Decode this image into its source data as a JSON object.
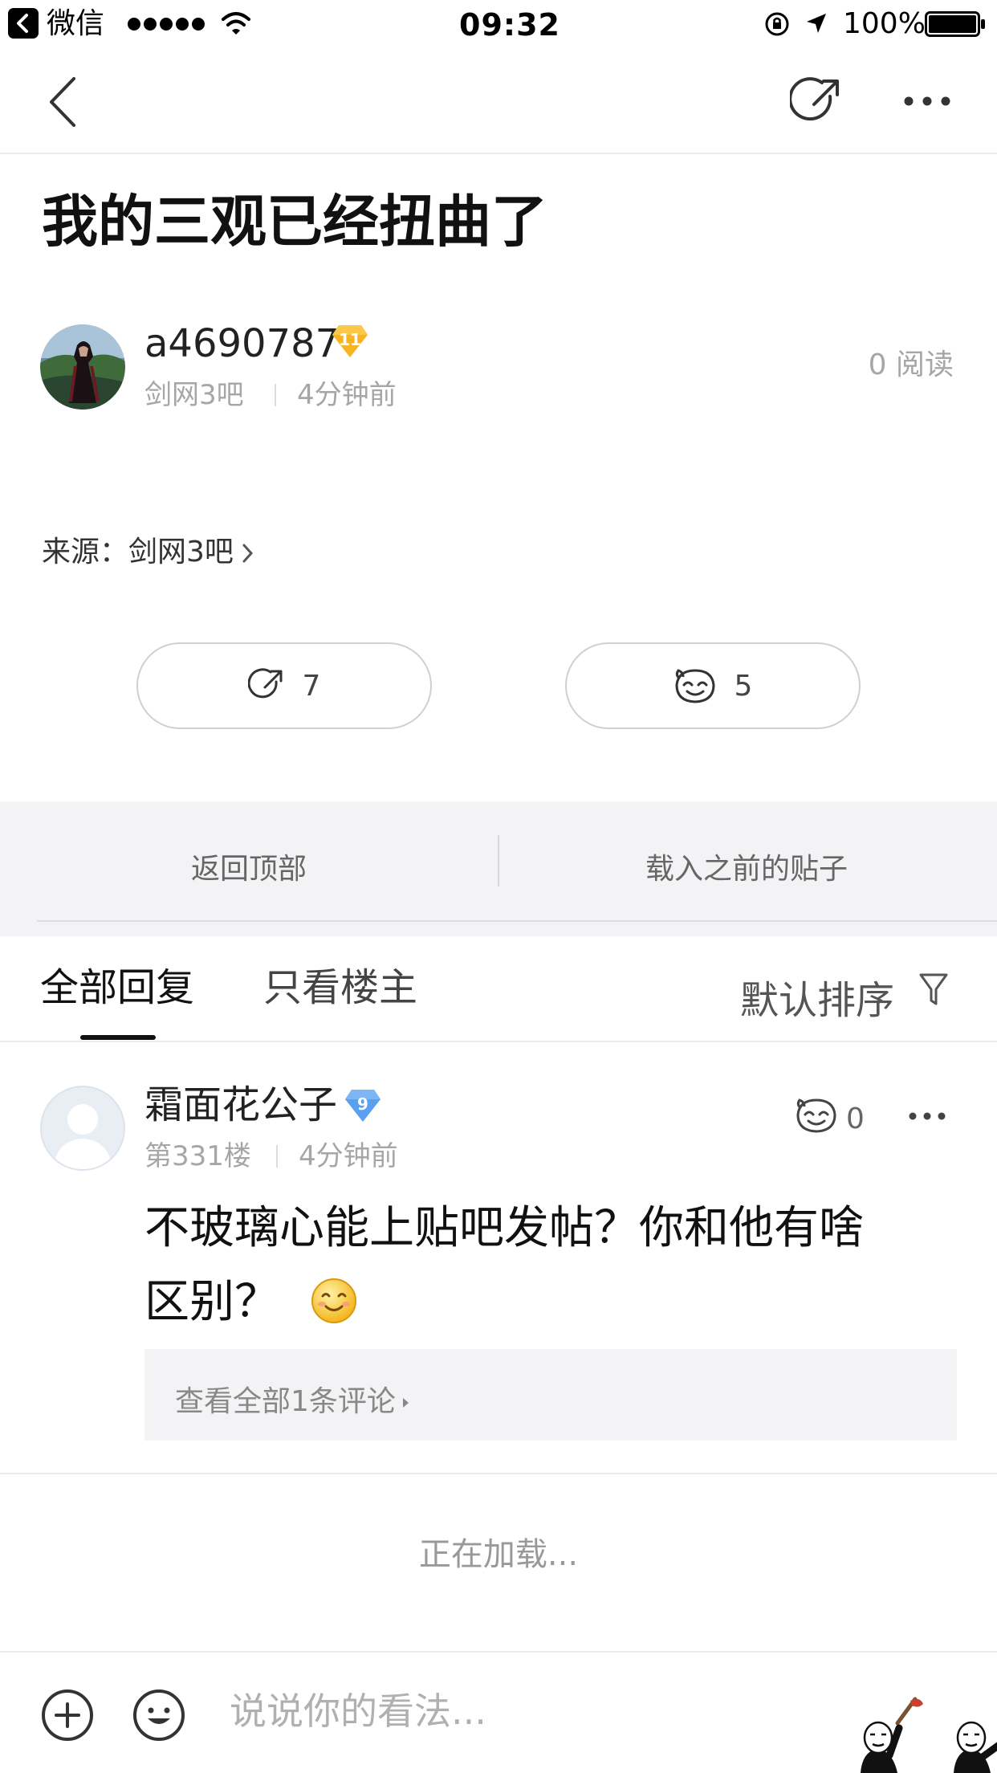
{
  "status_bar": {
    "back_app": "微信",
    "time": "09:32",
    "battery": "100%"
  },
  "post": {
    "title": "我的三观已经扭曲了",
    "author": "a4690787",
    "author_level": "11",
    "forum": "剑网3吧",
    "time_ago": "4分钟前",
    "read_count": "0 阅读",
    "source_label": "来源：",
    "source_forum": "剑网3吧",
    "share_count": "7",
    "like_count": "5"
  },
  "nav_bar": {
    "back_to_top": "返回顶部",
    "load_previous": "载入之前的贴子"
  },
  "tabs": {
    "all_replies": "全部回复",
    "only_op": "只看楼主",
    "sort": "默认排序"
  },
  "reply": {
    "name": "霜面花公子",
    "level": "9",
    "floor": "第331楼",
    "time_ago": "4分钟前",
    "like_count": "0",
    "body_line1": "不玻璃心能上贴吧发帖？你和他有啥",
    "body_line2": "区别？",
    "view_comments": "查看全部1条评论"
  },
  "loading_text": "正在加载...",
  "bottom_bar": {
    "placeholder": "说说你的看法..."
  }
}
